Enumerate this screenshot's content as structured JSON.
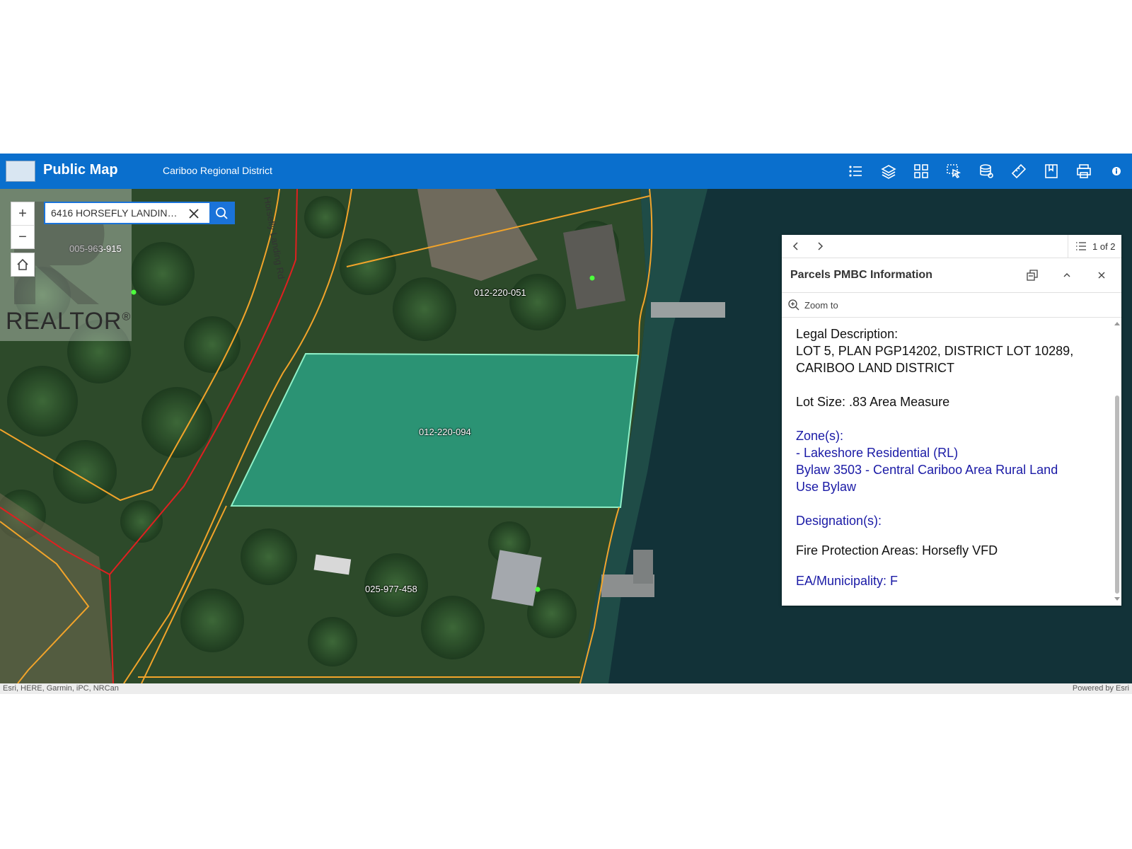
{
  "header": {
    "app_title": "Public Map",
    "subtitle": "Cariboo Regional District",
    "toolbar_icons": [
      "list-icon",
      "layers-icon",
      "basemap-gallery-icon",
      "select-icon",
      "data-icon",
      "measure-icon",
      "bookmark-icon",
      "print-icon",
      "info-icon"
    ]
  },
  "search": {
    "value": "6416 HORSEFLY LANDIN…"
  },
  "map": {
    "road_label": "Horsefly Landing Rd",
    "parcel_labels": [
      "005-963-915",
      "012-220-051",
      "012-220-094",
      "025-977-458"
    ],
    "highlight_color": "#2ad0b0",
    "parcel_line_color": "#f2a42a",
    "road_line_color": "#e02020",
    "attribution_left": "Esri, HERE, Garmin, iPC, NRCan",
    "attribution_right": "Powered by Esri"
  },
  "watermark": {
    "text": "REALTOR",
    "registered": "®"
  },
  "popup": {
    "pager": "1 of 2",
    "title": "Parcels PMBC Information",
    "zoom_to": "Zoom to",
    "lines": {
      "legal_heading": "Legal Description:",
      "legal_1": "LOT 5, PLAN PGP14202, DISTRICT LOT 10289,",
      "legal_2": "CARIBOO LAND DISTRICT",
      "lot_size": "Lot Size: .83 Area Measure",
      "zones_heading": "Zone(s):",
      "zone_1": "- Lakeshore Residential (RL)",
      "bylaw_1": "Bylaw 3503 - Central Cariboo Area Rural Land",
      "bylaw_2": "Use Bylaw",
      "designations": "Designation(s):",
      "fire": "Fire Protection Areas: Horsefly VFD",
      "ea": "EA/Municipality: F"
    }
  }
}
